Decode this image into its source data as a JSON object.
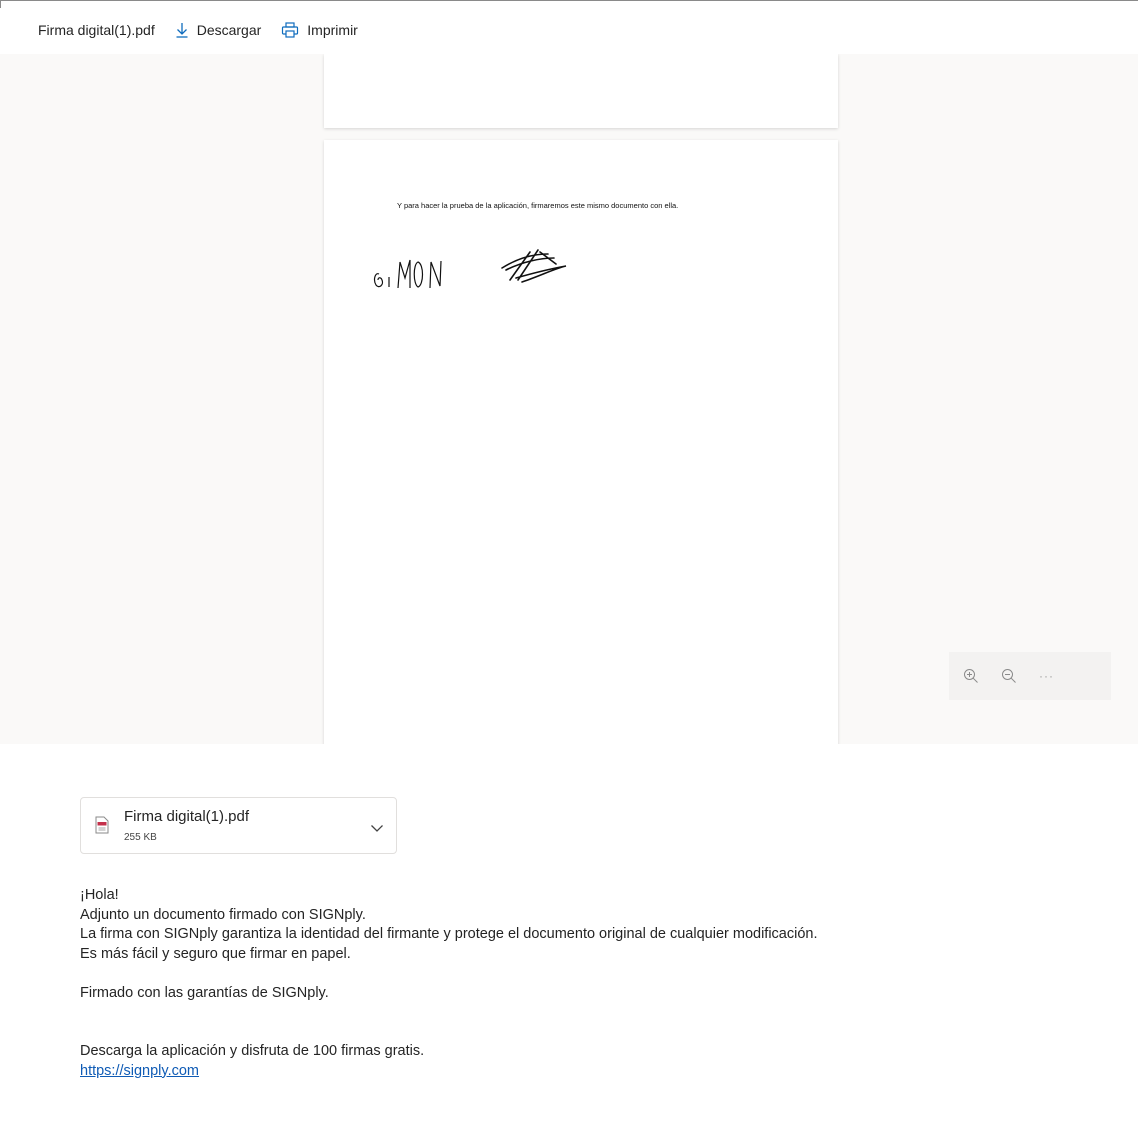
{
  "toolbar": {
    "file_name": "Firma digital(1).pdf",
    "download_label": "Descargar",
    "print_label": "Imprimir"
  },
  "document": {
    "page_text": "Y para hacer la prueba de la aplicación, firmaremos este mismo documento con ella."
  },
  "zoom_controls": {
    "more_label": "···"
  },
  "attachment": {
    "name": "Firma digital(1).pdf",
    "size": "255 KB"
  },
  "message": {
    "greeting": "¡Hola!",
    "line1": "Adjunto un documento firmado con SIGNply.",
    "line2": "La firma con SIGNply garantiza la identidad del firmante y protege el documento original de cualquier modificación.",
    "line3": "Es más fácil y seguro que firmar en papel.",
    "line4": "Firmado con las garantías de SIGNply.",
    "line5": "Descarga la aplicación y disfruta de 100 firmas gratis.",
    "link": "https://signply.com"
  },
  "colors": {
    "accent": "#0f6cbd",
    "link": "#0f5bb5",
    "preview_bg": "#faf9f8"
  }
}
